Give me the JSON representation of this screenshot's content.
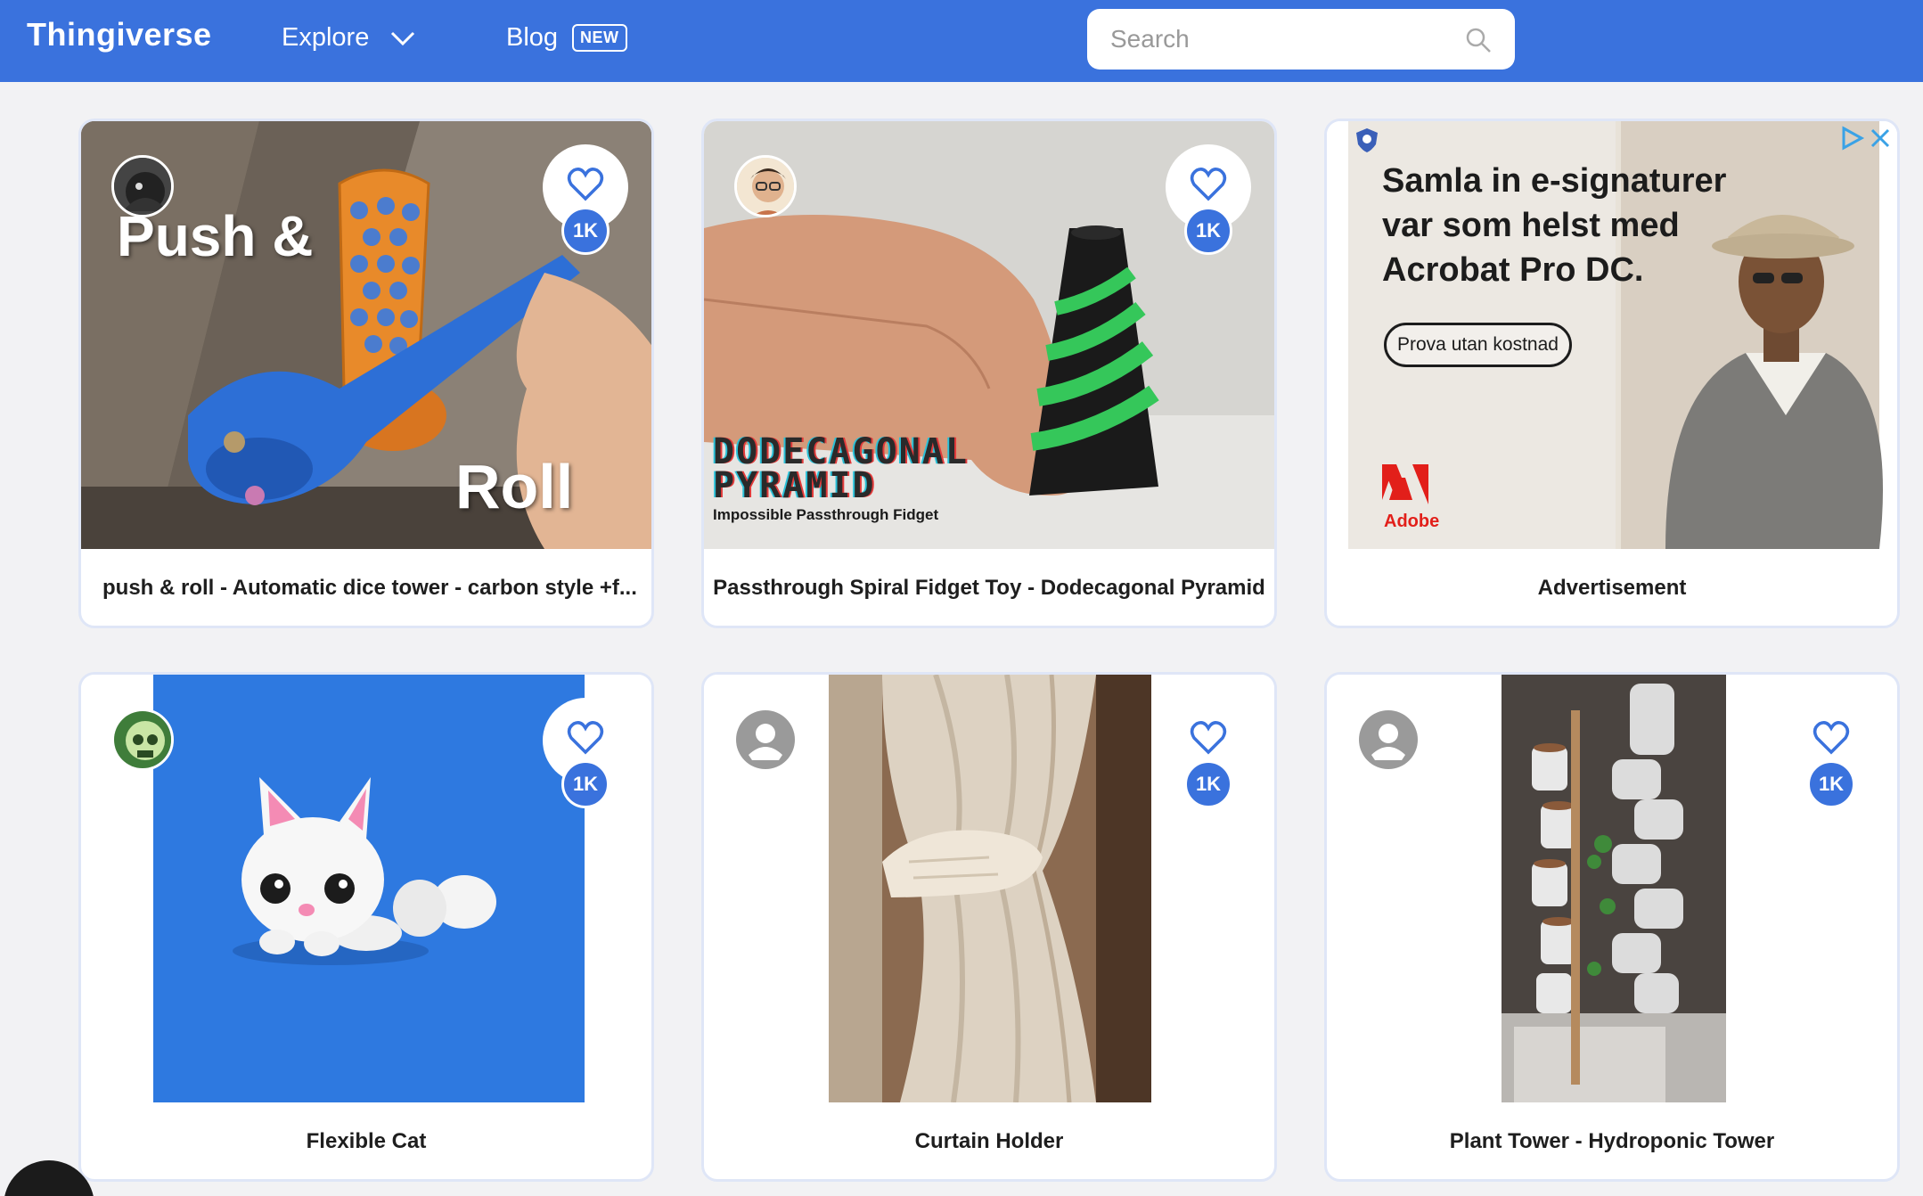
{
  "header": {
    "logo": "Thingiverse",
    "explore": "Explore",
    "blog": "Blog",
    "blog_badge": "NEW",
    "search_placeholder": "Search"
  },
  "colors": {
    "brand": "#3a72dd",
    "card_border": "#dfe6f7",
    "page_bg": "#f2f2f4"
  },
  "cards": [
    {
      "title": "push & roll - Automatic dice tower - carbon style +f...",
      "likes": "1K",
      "overlay_top": "Push &",
      "overlay_bottom": "Roll"
    },
    {
      "title": "Passthrough Spiral Fidget Toy - Dodecagonal Pyramid",
      "likes": "1K",
      "overlay_big_1": "DODECAGONAL",
      "overlay_big_2": "PYRAMID",
      "overlay_small": "Impossible Passthrough Fidget"
    },
    {
      "title": "Advertisement",
      "ad_headline_1": "Samla in e-signaturer",
      "ad_headline_2": "var som helst med",
      "ad_headline_3": "Acrobat Pro DC.",
      "ad_cta": "Prova utan kostnad",
      "ad_brand": "Adobe"
    },
    {
      "title": "Flexible Cat",
      "likes": "1K"
    },
    {
      "title": "Curtain Holder",
      "likes": "1K"
    },
    {
      "title": "Plant Tower - Hydroponic Tower",
      "likes": "1K"
    }
  ]
}
